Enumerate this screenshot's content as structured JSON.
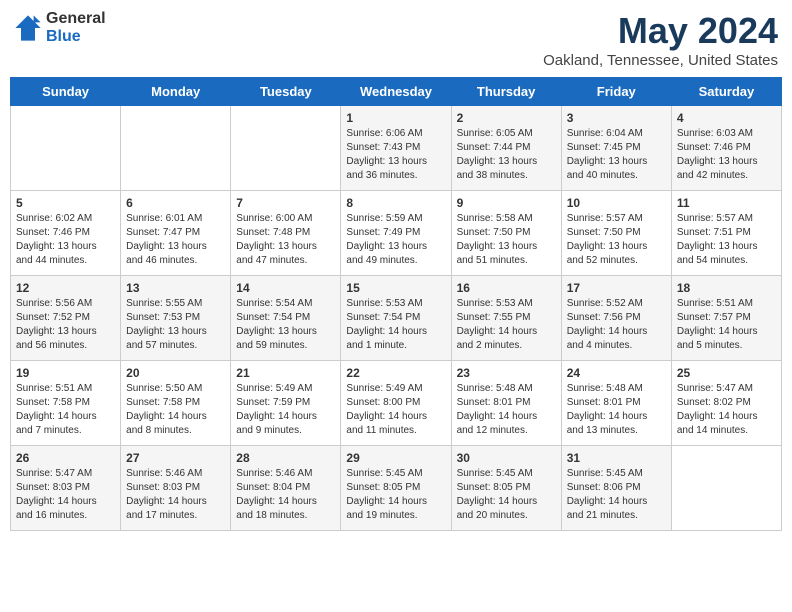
{
  "header": {
    "logo_general": "General",
    "logo_blue": "Blue",
    "month_title": "May 2024",
    "location": "Oakland, Tennessee, United States"
  },
  "days_of_week": [
    "Sunday",
    "Monday",
    "Tuesday",
    "Wednesday",
    "Thursday",
    "Friday",
    "Saturday"
  ],
  "weeks": [
    [
      {
        "day": null,
        "info": null
      },
      {
        "day": null,
        "info": null
      },
      {
        "day": null,
        "info": null
      },
      {
        "day": "1",
        "info": "Sunrise: 6:06 AM\nSunset: 7:43 PM\nDaylight: 13 hours\nand 36 minutes."
      },
      {
        "day": "2",
        "info": "Sunrise: 6:05 AM\nSunset: 7:44 PM\nDaylight: 13 hours\nand 38 minutes."
      },
      {
        "day": "3",
        "info": "Sunrise: 6:04 AM\nSunset: 7:45 PM\nDaylight: 13 hours\nand 40 minutes."
      },
      {
        "day": "4",
        "info": "Sunrise: 6:03 AM\nSunset: 7:46 PM\nDaylight: 13 hours\nand 42 minutes."
      }
    ],
    [
      {
        "day": "5",
        "info": "Sunrise: 6:02 AM\nSunset: 7:46 PM\nDaylight: 13 hours\nand 44 minutes."
      },
      {
        "day": "6",
        "info": "Sunrise: 6:01 AM\nSunset: 7:47 PM\nDaylight: 13 hours\nand 46 minutes."
      },
      {
        "day": "7",
        "info": "Sunrise: 6:00 AM\nSunset: 7:48 PM\nDaylight: 13 hours\nand 47 minutes."
      },
      {
        "day": "8",
        "info": "Sunrise: 5:59 AM\nSunset: 7:49 PM\nDaylight: 13 hours\nand 49 minutes."
      },
      {
        "day": "9",
        "info": "Sunrise: 5:58 AM\nSunset: 7:50 PM\nDaylight: 13 hours\nand 51 minutes."
      },
      {
        "day": "10",
        "info": "Sunrise: 5:57 AM\nSunset: 7:50 PM\nDaylight: 13 hours\nand 52 minutes."
      },
      {
        "day": "11",
        "info": "Sunrise: 5:57 AM\nSunset: 7:51 PM\nDaylight: 13 hours\nand 54 minutes."
      }
    ],
    [
      {
        "day": "12",
        "info": "Sunrise: 5:56 AM\nSunset: 7:52 PM\nDaylight: 13 hours\nand 56 minutes."
      },
      {
        "day": "13",
        "info": "Sunrise: 5:55 AM\nSunset: 7:53 PM\nDaylight: 13 hours\nand 57 minutes."
      },
      {
        "day": "14",
        "info": "Sunrise: 5:54 AM\nSunset: 7:54 PM\nDaylight: 13 hours\nand 59 minutes."
      },
      {
        "day": "15",
        "info": "Sunrise: 5:53 AM\nSunset: 7:54 PM\nDaylight: 14 hours\nand 1 minute."
      },
      {
        "day": "16",
        "info": "Sunrise: 5:53 AM\nSunset: 7:55 PM\nDaylight: 14 hours\nand 2 minutes."
      },
      {
        "day": "17",
        "info": "Sunrise: 5:52 AM\nSunset: 7:56 PM\nDaylight: 14 hours\nand 4 minutes."
      },
      {
        "day": "18",
        "info": "Sunrise: 5:51 AM\nSunset: 7:57 PM\nDaylight: 14 hours\nand 5 minutes."
      }
    ],
    [
      {
        "day": "19",
        "info": "Sunrise: 5:51 AM\nSunset: 7:58 PM\nDaylight: 14 hours\nand 7 minutes."
      },
      {
        "day": "20",
        "info": "Sunrise: 5:50 AM\nSunset: 7:58 PM\nDaylight: 14 hours\nand 8 minutes."
      },
      {
        "day": "21",
        "info": "Sunrise: 5:49 AM\nSunset: 7:59 PM\nDaylight: 14 hours\nand 9 minutes."
      },
      {
        "day": "22",
        "info": "Sunrise: 5:49 AM\nSunset: 8:00 PM\nDaylight: 14 hours\nand 11 minutes."
      },
      {
        "day": "23",
        "info": "Sunrise: 5:48 AM\nSunset: 8:01 PM\nDaylight: 14 hours\nand 12 minutes."
      },
      {
        "day": "24",
        "info": "Sunrise: 5:48 AM\nSunset: 8:01 PM\nDaylight: 14 hours\nand 13 minutes."
      },
      {
        "day": "25",
        "info": "Sunrise: 5:47 AM\nSunset: 8:02 PM\nDaylight: 14 hours\nand 14 minutes."
      }
    ],
    [
      {
        "day": "26",
        "info": "Sunrise: 5:47 AM\nSunset: 8:03 PM\nDaylight: 14 hours\nand 16 minutes."
      },
      {
        "day": "27",
        "info": "Sunrise: 5:46 AM\nSunset: 8:03 PM\nDaylight: 14 hours\nand 17 minutes."
      },
      {
        "day": "28",
        "info": "Sunrise: 5:46 AM\nSunset: 8:04 PM\nDaylight: 14 hours\nand 18 minutes."
      },
      {
        "day": "29",
        "info": "Sunrise: 5:45 AM\nSunset: 8:05 PM\nDaylight: 14 hours\nand 19 minutes."
      },
      {
        "day": "30",
        "info": "Sunrise: 5:45 AM\nSunset: 8:05 PM\nDaylight: 14 hours\nand 20 minutes."
      },
      {
        "day": "31",
        "info": "Sunrise: 5:45 AM\nSunset: 8:06 PM\nDaylight: 14 hours\nand 21 minutes."
      },
      {
        "day": null,
        "info": null
      }
    ]
  ]
}
